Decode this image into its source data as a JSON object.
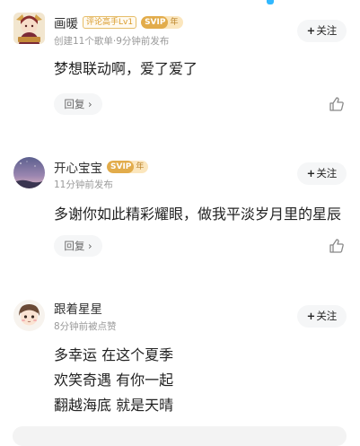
{
  "comments": [
    {
      "username": "画暖",
      "badge_title": "评论高手Lv1",
      "svip_label": "SVIP",
      "svip_year": "年",
      "meta": "创建11个歌单·9分钟前发布",
      "follow_label": "关注",
      "content_lines": [
        "梦想联动啊，爱了爱了"
      ],
      "reply_label": "回复",
      "avatar_icon": "anime-character-avatar"
    },
    {
      "username": "开心宝宝",
      "svip_label": "SVIP",
      "svip_year": "年",
      "meta": "11分钟前发布",
      "follow_label": "关注",
      "content_lines": [
        "多谢你如此精彩耀眼，做我平淡岁月里的星辰"
      ],
      "reply_label": "回复",
      "avatar_icon": "night-sky-avatar"
    },
    {
      "username": "跟着星星",
      "meta": "8分钟前被点赞",
      "follow_label": "关注",
      "content_lines": [
        "多幸运 在这个夏季",
        "欢笑奇遇 有你一起",
        "翻越海底 就是天晴"
      ],
      "avatar_icon": "chibi-character-avatar"
    }
  ],
  "colors": {
    "accent_blue": "#31b8ff",
    "svip_gold": "#e2ac4b",
    "meta_gray": "#9a9a9a"
  }
}
